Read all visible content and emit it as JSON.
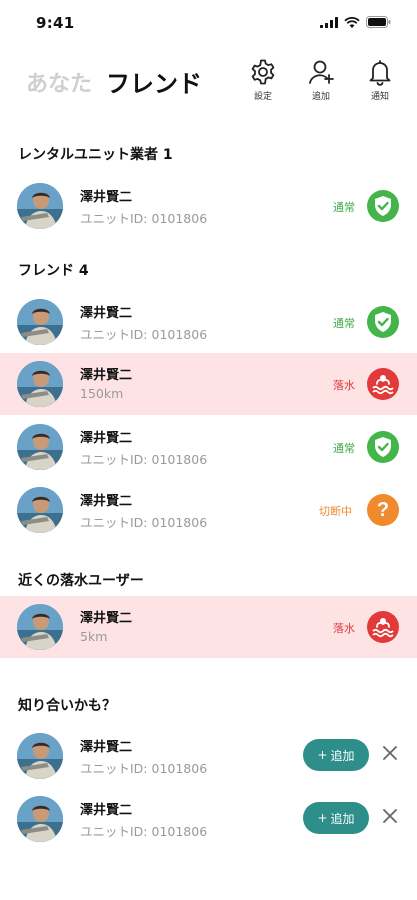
{
  "status_bar": {
    "time": "9:41"
  },
  "header": {
    "tab_you": "あなた",
    "tab_friend": "フレンド",
    "settings_label": "設定",
    "add_label": "追加",
    "notify_label": "通知"
  },
  "sections": {
    "rental": "レンタルユニット業者 1",
    "friends": "フレンド 4",
    "nearby": "近くの落水ユーザー",
    "suggest": "知り合いかも？"
  },
  "rental_rows": [
    {
      "name": "澤井賢二",
      "sub": "ユニットID: 0101806",
      "status": "通常",
      "status_type": "ok"
    }
  ],
  "friend_rows": [
    {
      "name": "澤井賢二",
      "sub": "ユニットID: 0101806",
      "status": "通常",
      "status_type": "ok"
    },
    {
      "name": "澤井賢二",
      "sub": "150km",
      "status": "落水",
      "status_type": "drown"
    },
    {
      "name": "澤井賢二",
      "sub": "ユニットID: 0101806",
      "status": "通常",
      "status_type": "ok"
    },
    {
      "name": "澤井賢二",
      "sub": "ユニットID: 0101806",
      "status": "切断中",
      "status_type": "lost",
      "icon_glyph": "?"
    }
  ],
  "nearby_rows": [
    {
      "name": "澤井賢二",
      "sub": "5km",
      "status": "落水",
      "status_type": "drown"
    }
  ],
  "suggest_rows": [
    {
      "name": "澤井賢二",
      "sub": "ユニットID: 0101806",
      "add_label": "追加",
      "plus": "+"
    },
    {
      "name": "澤井賢二",
      "sub": "ユニットID: 0101806",
      "add_label": "追加",
      "plus": "+"
    }
  ],
  "colors": {
    "ok": "#43b54a",
    "drown": "#e23a3a",
    "lost": "#f08a2c",
    "alert_bg": "#fde3e4",
    "add_button": "#2e8f8a"
  },
  "icons": {
    "settings": "gear-icon",
    "add": "add-user-icon",
    "notify": "bell-icon",
    "ok": "shield-check-icon",
    "drown": "drowning-icon",
    "lost": "question-icon",
    "dismiss": "close-icon"
  }
}
